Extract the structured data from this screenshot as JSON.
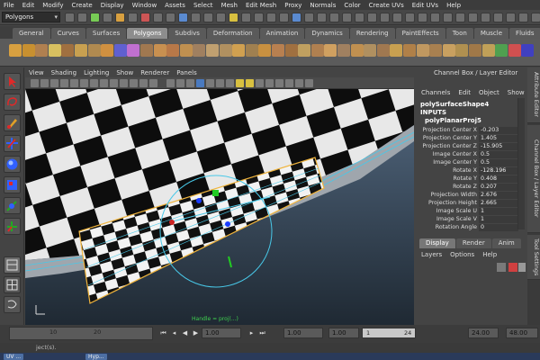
{
  "menu": [
    "File",
    "Edit",
    "Modify",
    "Create",
    "Display",
    "Window",
    "Assets",
    "Select",
    "Mesh",
    "Edit Mesh",
    "Proxy",
    "Normals",
    "Color",
    "Create UVs",
    "Edit UVs",
    "Help"
  ],
  "mode_selector": "Polygons",
  "shelf_tabs": [
    "General",
    "Curves",
    "Surfaces",
    "Polygons",
    "Subdivs",
    "Deformation",
    "Animation",
    "Dynamics",
    "Rendering",
    "PaintEffects",
    "Toon",
    "Muscle",
    "Fluids",
    "Fur"
  ],
  "active_shelf_tab": "Polygons",
  "viewport": {
    "menu": [
      "View",
      "Shading",
      "Lighting",
      "Show",
      "Renderer",
      "Panels"
    ],
    "manip_label": "Handle = proj(...)"
  },
  "channel_box": {
    "title": "Channel Box / Layer Editor",
    "menu": [
      "Channels",
      "Edit",
      "Object",
      "Show"
    ],
    "shape": "polySurfaceShape4",
    "inputs_label": "INPUTS",
    "node": "polyPlanarProj5",
    "attributes": [
      {
        "label": "Projection Center X",
        "value": "-0.203"
      },
      {
        "label": "Projection Center Y",
        "value": "1.405"
      },
      {
        "label": "Projection Center Z",
        "value": "-15.905"
      },
      {
        "label": "Image Center X",
        "value": "0.5"
      },
      {
        "label": "Image Center Y",
        "value": "0.5"
      },
      {
        "label": "Rotate X",
        "value": "-128.196"
      },
      {
        "label": "Rotate Y",
        "value": "0.408"
      },
      {
        "label": "Rotate Z",
        "value": "0.207"
      },
      {
        "label": "Projection Width",
        "value": "2.676"
      },
      {
        "label": "Projection Height",
        "value": "2.665"
      },
      {
        "label": "Image Scale U",
        "value": "1"
      },
      {
        "label": "Image Scale V",
        "value": "1"
      },
      {
        "label": "Rotation Angle",
        "value": "0"
      }
    ]
  },
  "layer_editor": {
    "tabs": [
      "Display",
      "Render",
      "Anim"
    ],
    "active_tab": "Display",
    "menu": [
      "Layers",
      "Options",
      "Help"
    ]
  },
  "side_tabs": [
    "Attribute Editor",
    "Channel Box / Layer Editor",
    "Tool Settings"
  ],
  "timeline": {
    "ticks": [
      "10",
      "20"
    ],
    "current_frame": "1.00",
    "start_frame": "1.00",
    "range_start_small": "1.00",
    "range_left": "1",
    "range_right": "24",
    "end_frame": "24.00",
    "max_frame": "48.00"
  },
  "help_line": "ject(s).",
  "taskbar": [
    "UV ...",
    "Hyp..."
  ],
  "colors": {
    "accent": "#8d8d8d",
    "wire": "#48c8e8",
    "selection": "#f0b43c",
    "manip_green": "#22cc22",
    "manip_blue": "#1a3cff",
    "manip_red": "#cc2222"
  }
}
